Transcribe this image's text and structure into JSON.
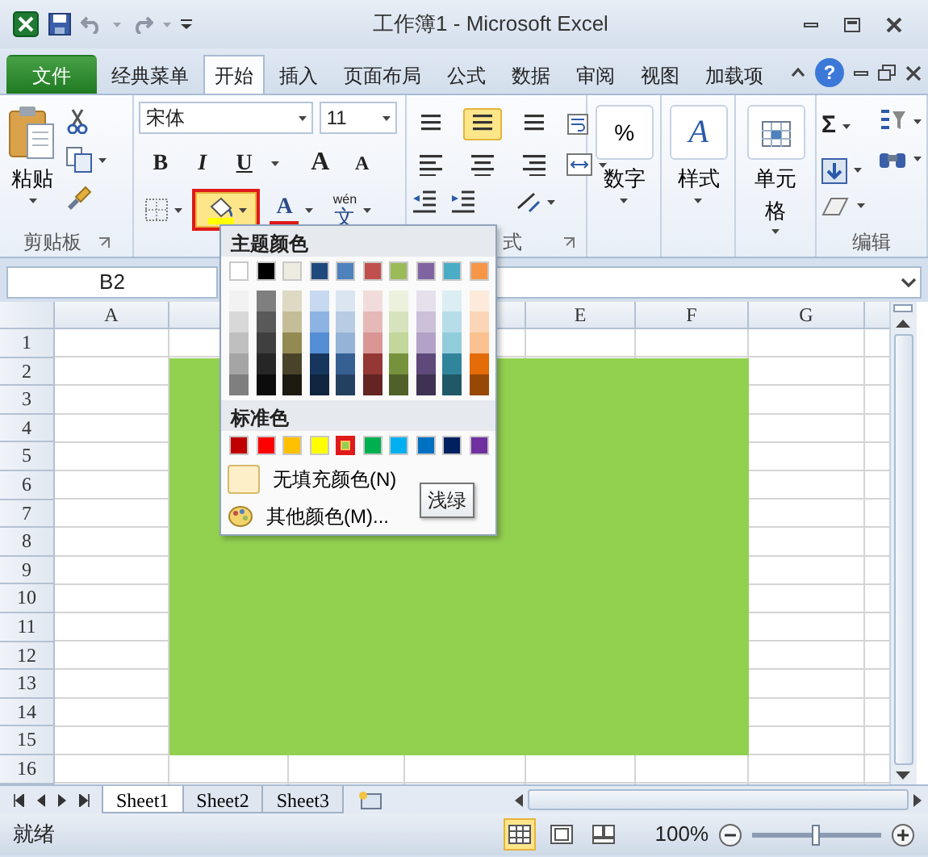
{
  "window": {
    "title": "工作簿1 - Microsoft Excel"
  },
  "ribbon_tabs": [
    {
      "label": "文件",
      "kind": "file",
      "selected": false
    },
    {
      "label": "经典菜单",
      "kind": "tab",
      "selected": false
    },
    {
      "label": "开始",
      "kind": "tab",
      "selected": true
    },
    {
      "label": "插入",
      "kind": "tab",
      "selected": false
    },
    {
      "label": "页面布局",
      "kind": "tab",
      "selected": false
    },
    {
      "label": "公式",
      "kind": "tab",
      "selected": false
    },
    {
      "label": "数据",
      "kind": "tab",
      "selected": false
    },
    {
      "label": "审阅",
      "kind": "tab",
      "selected": false
    },
    {
      "label": "视图",
      "kind": "tab",
      "selected": false
    },
    {
      "label": "加载项",
      "kind": "tab",
      "selected": false
    }
  ],
  "help_glyph": "?",
  "clipboard": {
    "paste": "粘贴",
    "group_label": "剪贴板"
  },
  "font": {
    "name": "宋体",
    "size": "11",
    "format_buttons": [
      {
        "glyph": "B",
        "kind": "bold"
      },
      {
        "glyph": "I",
        "kind": "italic"
      },
      {
        "glyph": "U",
        "kind": "underline"
      }
    ],
    "grow_glyph": "A",
    "shrink_glyph": "A",
    "fill_button": {
      "open": true,
      "outlined": true
    },
    "font_color_glyph": "A",
    "phonetic": {
      "top": "wén",
      "bottom": "文"
    }
  },
  "alignment": {
    "group_label": "式",
    "middle_selected": true
  },
  "number": {
    "glyph": "%",
    "label": "数字"
  },
  "styles": {
    "glyph": "A",
    "label": "样式"
  },
  "cells": {
    "label": "单元格"
  },
  "editing": {
    "sum_glyph": "Σ",
    "group_label": "编辑"
  },
  "formula_bar": {
    "name_box": "B2"
  },
  "fill_menu": {
    "theme_title": "主题颜色",
    "theme_colors": [
      {
        "color": "#ffffff",
        "shades": [
          {
            "color": "#f2f2f2"
          },
          {
            "color": "#d8d8d8"
          },
          {
            "color": "#bfbfbf"
          },
          {
            "color": "#a5a5a5"
          },
          {
            "color": "#7f7f7f"
          }
        ]
      },
      {
        "color": "#000000",
        "shades": [
          {
            "color": "#7f7f7f"
          },
          {
            "color": "#595959"
          },
          {
            "color": "#3f3f3f"
          },
          {
            "color": "#262626"
          },
          {
            "color": "#0c0c0c"
          }
        ]
      },
      {
        "color": "#eeece1",
        "shades": [
          {
            "color": "#ddd9c3"
          },
          {
            "color": "#c4bd97"
          },
          {
            "color": "#938953"
          },
          {
            "color": "#494429"
          },
          {
            "color": "#1d1b10"
          }
        ]
      },
      {
        "color": "#1f497d",
        "shades": [
          {
            "color": "#c6d9f0"
          },
          {
            "color": "#8db3e2"
          },
          {
            "color": "#548dd4"
          },
          {
            "color": "#17365d"
          },
          {
            "color": "#0f243e"
          }
        ]
      },
      {
        "color": "#4f81bd",
        "shades": [
          {
            "color": "#dbe5f1"
          },
          {
            "color": "#b8cce4"
          },
          {
            "color": "#95b3d7"
          },
          {
            "color": "#366092"
          },
          {
            "color": "#244061"
          }
        ]
      },
      {
        "color": "#c0504d",
        "shades": [
          {
            "color": "#f2dcdb"
          },
          {
            "color": "#e5b9b7"
          },
          {
            "color": "#d99694"
          },
          {
            "color": "#953734"
          },
          {
            "color": "#632423"
          }
        ]
      },
      {
        "color": "#9bbb59",
        "shades": [
          {
            "color": "#ebf1dd"
          },
          {
            "color": "#d7e3bc"
          },
          {
            "color": "#c3d69b"
          },
          {
            "color": "#76923c"
          },
          {
            "color": "#4f6128"
          }
        ]
      },
      {
        "color": "#8064a2",
        "shades": [
          {
            "color": "#e5e0ec"
          },
          {
            "color": "#ccc1d9"
          },
          {
            "color": "#b2a2c7"
          },
          {
            "color": "#5f497a"
          },
          {
            "color": "#3f3151"
          }
        ]
      },
      {
        "color": "#4bacc6",
        "shades": [
          {
            "color": "#dbeef3"
          },
          {
            "color": "#b7dde8"
          },
          {
            "color": "#92cddc"
          },
          {
            "color": "#31859b"
          },
          {
            "color": "#205867"
          }
        ]
      },
      {
        "color": "#f79646",
        "shades": [
          {
            "color": "#fdeada"
          },
          {
            "color": "#fbd5b5"
          },
          {
            "color": "#fac08f"
          },
          {
            "color": "#e36c09"
          },
          {
            "color": "#974806"
          }
        ]
      }
    ],
    "standard_title": "标准色",
    "standard_colors": [
      {
        "color": "#c00000",
        "selected": false
      },
      {
        "color": "#ff0000",
        "selected": false
      },
      {
        "color": "#ffc000",
        "selected": false
      },
      {
        "color": "#ffff00",
        "selected": false
      },
      {
        "color": "#92d050",
        "selected": true
      },
      {
        "color": "#00b050",
        "selected": false
      },
      {
        "color": "#00b0f0",
        "selected": false
      },
      {
        "color": "#0070c0",
        "selected": false
      },
      {
        "color": "#002060",
        "selected": false
      },
      {
        "color": "#7030a0",
        "selected": false
      }
    ],
    "no_fill": "无填充颜色(N)",
    "more_colors": "其他颜色(M)...",
    "tooltip": "浅绿"
  },
  "sheet": {
    "fill": {
      "color": "#92d050"
    },
    "columns": [
      {
        "label": "A"
      },
      {},
      {},
      {},
      {
        "label": "E"
      },
      {
        "label": "F"
      },
      {
        "label": "G"
      }
    ],
    "rows": [
      {
        "label": "1"
      },
      {
        "label": "2"
      },
      {
        "label": "3"
      },
      {
        "label": "4"
      },
      {
        "label": "5"
      },
      {
        "label": "6"
      },
      {
        "label": "7"
      },
      {
        "label": "8"
      },
      {
        "label": "9"
      },
      {
        "label": "10"
      },
      {
        "label": "11"
      },
      {
        "label": "12"
      },
      {
        "label": "13"
      },
      {
        "label": "14"
      },
      {
        "label": "15"
      },
      {
        "label": "16"
      }
    ]
  },
  "sheet_tabs": [
    {
      "label": "Sheet1",
      "selected": true
    },
    {
      "label": "Sheet2",
      "selected": false
    },
    {
      "label": "Sheet3",
      "selected": false
    }
  ],
  "status_bar": {
    "status": "就绪",
    "views": [
      {
        "kind": "normal",
        "selected": true
      },
      {
        "kind": "page_layout",
        "selected": false
      },
      {
        "kind": "page_break",
        "selected": false
      }
    ],
    "zoom": "100%",
    "zoom_slider": {
      "level": 0.5
    }
  }
}
